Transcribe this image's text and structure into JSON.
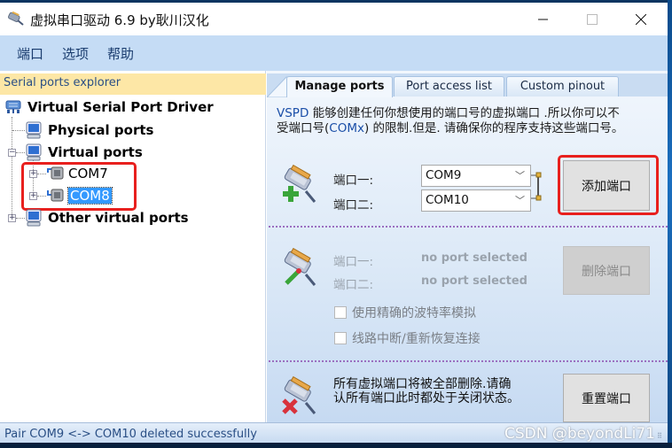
{
  "window": {
    "title": "虚拟串口驱动 6.9 by耿川汉化",
    "icon": "serial-plug-icon",
    "controls": {
      "minimize": "—",
      "maximize": "☐",
      "close": "✕"
    }
  },
  "menu": {
    "items": [
      {
        "label": "端口"
      },
      {
        "label": "选项"
      },
      {
        "label": "帮助"
      }
    ]
  },
  "explorer": {
    "header": "Serial ports explorer",
    "tree": {
      "root": {
        "label": "Virtual Serial Port Driver",
        "icon": "serial-port-icon"
      },
      "physical": {
        "label": "Physical ports",
        "icon": "computer-icon"
      },
      "virtual": {
        "label": "Virtual ports",
        "icon": "computer-icon",
        "expanded": true,
        "children": [
          {
            "label": "COM7",
            "icon": "com-port-icon",
            "selected": false
          },
          {
            "label": "COM8",
            "icon": "com-port-icon",
            "selected": true
          }
        ]
      },
      "other": {
        "label": "Other virtual ports",
        "icon": "computer-icon"
      }
    }
  },
  "tabs": [
    {
      "label": "Manage ports",
      "active": true
    },
    {
      "label": "Port access list",
      "active": false
    },
    {
      "label": "Custom pinout",
      "active": false
    }
  ],
  "manage": {
    "description_prefix": "VSPD",
    "description_line1": " 能够创建任何你想使用的端口号的虚拟端口 .所以你可以不",
    "description_line2_a": "受端口号(",
    "description_line2_hl": "COMx",
    "description_line2_b": ") 的限制.但是. 请确保你的程序支持这些端口号。",
    "add": {
      "port1_label": "端口一:",
      "port2_label": "端口二:",
      "port1_value": "COM9",
      "port2_value": "COM10",
      "button": "添加端口"
    },
    "delete": {
      "port1_label": "端口一:",
      "port2_label": "端口二:",
      "port1_value": "no port selected",
      "port2_value": "no port selected",
      "button": "删除端口",
      "options": [
        {
          "label": "使用精确的波特率模拟",
          "checked": false
        },
        {
          "label": "线路中断/重新恢复连接",
          "checked": false
        }
      ]
    },
    "reset": {
      "text": "所有虚拟端口将被全部删除.请确认所有端口此时都处于关闭状态。",
      "button": "重置端口"
    }
  },
  "status": {
    "message": "Pair COM9 <-> COM10 deleted successfully",
    "watermark": "CSDN @beyondLi71"
  },
  "colors": {
    "menubar": "#c5dcf5",
    "explorer_header": "#fde7a6",
    "selection": "#3399ff",
    "annotation_red": "#e8201e",
    "separator": "#9b6fc0"
  }
}
